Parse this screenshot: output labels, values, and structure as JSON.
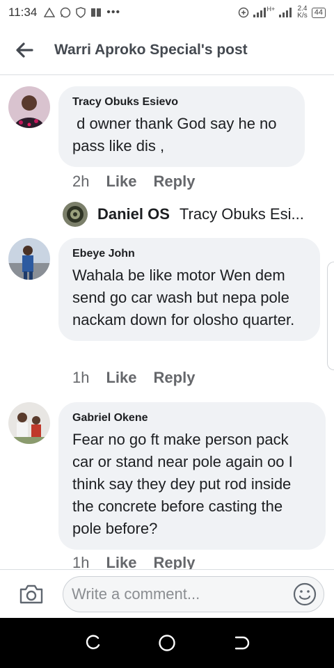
{
  "status_bar": {
    "time": "11:34",
    "speed_top": "2.4",
    "speed_bottom": "K/s",
    "battery": "44",
    "network": "H+"
  },
  "header": {
    "title": "Warri Aproko Special's post"
  },
  "comments": [
    {
      "author": "Tracy Obuks Esievo",
      "text": " d owner thank God say he no pass like dis ,",
      "time": "2h",
      "like": "Like",
      "reply": "Reply"
    },
    {
      "author": "Ebeye John",
      "text": "Wahala be like motor Wen dem send go car wash but nepa pole nackam down for olosho quarter.",
      "time": "1h",
      "like": "Like",
      "reply": "Reply"
    },
    {
      "author": "Gabriel Okene",
      "text": "Fear no go ft make person pack car or stand near pole again oo I think say they dey put rod inside the concrete before casting the pole before?",
      "time": "1h",
      "like": "Like",
      "reply": "Reply"
    }
  ],
  "reply_preview": {
    "name": "Daniel OS",
    "text": "Tracy Obuks Esi..."
  },
  "composer": {
    "placeholder": "Write a comment..."
  },
  "colors": {
    "bubble": "#f0f2f5",
    "meta": "#65676b",
    "header_text": "#444950"
  }
}
